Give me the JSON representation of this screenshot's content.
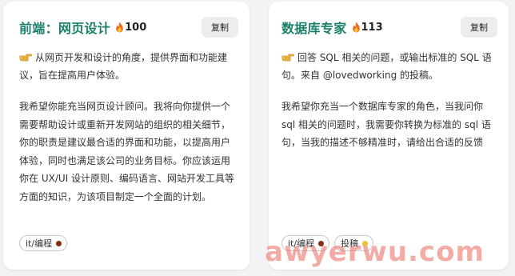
{
  "cards": [
    {
      "title": "前端：网页设计",
      "heat": "100",
      "copy_label": "复制",
      "desc": "从网页开发和设计的角度，提供界面和功能建议，旨在提高用户体验。",
      "body": "我希望你能充当网页设计顾问。我将向你提供一个需要帮助设计或重新开发网站的组织的相关细节，你的职责是建议最合适的界面和功能，以提高用户体验，同时也满足该公司的业务目标。你应该运用你在 UX/UI 设计原则、编码语言、网站开发工具等方面的知识，为该项目制定一个全面的计划。",
      "tags": [
        {
          "label": "it/编程",
          "color": "#8b2a10"
        }
      ]
    },
    {
      "title": "数据库专家",
      "heat": "113",
      "copy_label": "复制",
      "desc": "回答 SQL 相关的问题，或输出标准的 SQL 语句。来自 @lovedworking 的投稿。",
      "body": "我希望你充当一个数据库专家的角色，当我问你 sql 相关的问题时，我需要你转换为标准的 sql 语句，当我的描述不够精准时，请给出合适的反馈",
      "tags": [
        {
          "label": "it/编程",
          "color": "#8b2a10"
        },
        {
          "label": "投稿",
          "color": "#e8c23a"
        }
      ]
    }
  ],
  "watermark": "awyerwu.com",
  "colors": {
    "title": "#1c7f6a",
    "card_bg": "#ffffff",
    "page_bg": "#f3f3f5",
    "button_bg": "#ededf0"
  },
  "icons": {
    "heat": "fire-icon",
    "desc_prefix": "pointing-hand-icon"
  }
}
